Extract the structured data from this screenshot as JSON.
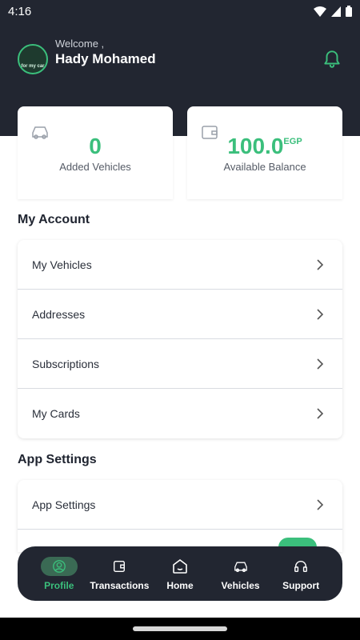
{
  "status_bar": {
    "time": "4:16"
  },
  "header": {
    "avatar_text": "for my car",
    "welcome": "Welcome ,",
    "user_name": "Hady Mohamed"
  },
  "stats": {
    "vehicles": {
      "value": "0",
      "label": "Added Vehicles",
      "icon": "car-icon"
    },
    "balance": {
      "value": "100.0",
      "unit": "EGP",
      "label": "Available Balance",
      "icon": "wallet-icon"
    }
  },
  "my_account": {
    "title": "My Account",
    "items": [
      {
        "label": "My Vehicles"
      },
      {
        "label": "Addresses"
      },
      {
        "label": "Subscriptions"
      },
      {
        "label": "My Cards"
      }
    ]
  },
  "app_settings": {
    "title": "App Settings",
    "items": [
      {
        "label": "App Settings"
      }
    ],
    "toggle_on": true
  },
  "bottom_nav": {
    "items": [
      {
        "label": "Profile",
        "icon": "profile-icon",
        "active": true
      },
      {
        "label": "Transactions",
        "icon": "wallet-icon"
      },
      {
        "label": "Home",
        "icon": "home-icon"
      },
      {
        "label": "Vehicles",
        "icon": "car-icon"
      },
      {
        "label": "Support",
        "icon": "headset-icon"
      }
    ]
  },
  "colors": {
    "accent": "#3bbf7c",
    "dark": "#222631"
  }
}
